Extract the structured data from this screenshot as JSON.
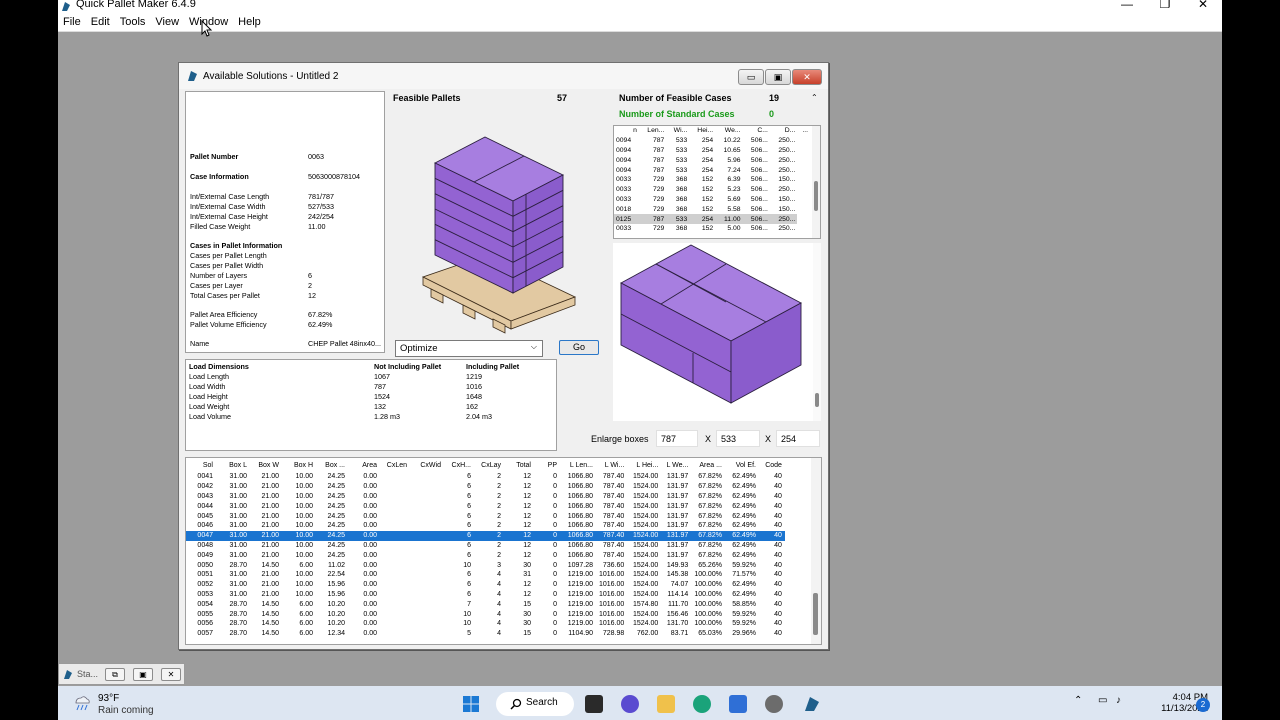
{
  "app": {
    "title": "Quick Pallet Maker 6.4.9",
    "window_buttons": [
      "—",
      "❐",
      "✕"
    ],
    "menu": [
      "File",
      "Edit",
      "Tools",
      "View",
      "Window",
      "Help"
    ]
  },
  "dialog": {
    "title": "Available Solutions - Untitled 2",
    "buttons": [
      "▭",
      "▣",
      "✕"
    ]
  },
  "info": {
    "rows": [
      {
        "label": "Pallet Number",
        "value": "0063",
        "bold": true
      },
      {
        "label": "Case Information",
        "value": "5063000878104",
        "bold": true
      },
      {
        "label": "Int/External Case Length",
        "value": "781/787"
      },
      {
        "label": "Int/External Case Width",
        "value": "527/533"
      },
      {
        "label": "Int/External Case Height",
        "value": "242/254"
      },
      {
        "label": "Filled Case Weight",
        "value": "11.00"
      },
      {
        "label": "Cases in Pallet Information",
        "value": "",
        "bold": true
      },
      {
        "label": "Cases per Pallet Length",
        "value": ""
      },
      {
        "label": "Cases per Pallet Width",
        "value": ""
      },
      {
        "label": "Number of Layers",
        "value": "6"
      },
      {
        "label": "Cases per Layer",
        "value": "2"
      },
      {
        "label": "Total Cases per Pallet",
        "value": "12"
      },
      {
        "label": "Pallet Area Efficiency",
        "value": "67.82%"
      },
      {
        "label": "Pallet Volume Efficiency",
        "value": "62.49%"
      },
      {
        "label": "Name",
        "value": "CHEP Pallet 48inx40..."
      }
    ]
  },
  "load": {
    "headers": [
      "Load Dimensions",
      "Not Including Pallet",
      "Including Pallet"
    ],
    "rows": [
      [
        "Load Length",
        "1067",
        "1219"
      ],
      [
        "Load Width",
        "787",
        "1016"
      ],
      [
        "Load Height",
        "1524",
        "1648"
      ],
      [
        "Load Weight",
        "132",
        "162"
      ],
      [
        "Load Volume",
        "1.28 m3",
        "2.04 m3"
      ]
    ]
  },
  "feasible": {
    "label": "Feasible Pallets",
    "count": "57"
  },
  "cases_summary": {
    "feasible_label": "Number of Feasible Cases",
    "feasible_count": "19",
    "standard_label": "Number of Standard Cases",
    "standard_count": "0"
  },
  "cases_table": {
    "headers": [
      "n",
      "Len...",
      "Wi...",
      "Hei...",
      "We...",
      "C...",
      "D...",
      "..."
    ],
    "rows": [
      [
        "0094",
        "787",
        "533",
        "254",
        "10.22",
        "506...",
        "250..."
      ],
      [
        "0094",
        "787",
        "533",
        "254",
        "10.65",
        "506...",
        "250..."
      ],
      [
        "0094",
        "787",
        "533",
        "254",
        "5.96",
        "506...",
        "250..."
      ],
      [
        "0094",
        "787",
        "533",
        "254",
        "7.24",
        "506...",
        "250..."
      ],
      [
        "0033",
        "729",
        "368",
        "152",
        "6.39",
        "506...",
        "150..."
      ],
      [
        "0033",
        "729",
        "368",
        "152",
        "5.23",
        "506...",
        "250..."
      ],
      [
        "0033",
        "729",
        "368",
        "152",
        "5.69",
        "506...",
        "150..."
      ],
      [
        "0018",
        "729",
        "368",
        "152",
        "5.58",
        "506...",
        "150..."
      ],
      [
        "0125",
        "787",
        "533",
        "254",
        "11.00",
        "506...",
        "250..."
      ],
      [
        "0033",
        "729",
        "368",
        "152",
        "5.00",
        "506...",
        "250..."
      ]
    ],
    "selected_index": 8
  },
  "optimize": {
    "value": "Optimize",
    "go": "Go"
  },
  "enlarge": {
    "label": "Enlarge boxes",
    "x": "787",
    "y": "533",
    "z": "254",
    "sep": "X"
  },
  "solutions": {
    "headers": [
      "Sol",
      "Box L",
      "Box W",
      "Box H",
      "Box ...",
      "Area",
      "CxLen",
      "CxWid",
      "CxH...",
      "CxLay",
      "Total",
      "PP",
      "L Len...",
      "L Wi...",
      "L Hei...",
      "L We...",
      "Area ...",
      "Vol Ef.",
      "Code"
    ],
    "rows": [
      [
        "0041",
        "31.00",
        "21.00",
        "10.00",
        "24.25",
        "0.00",
        "",
        "",
        "6",
        "2",
        "12",
        "0",
        "1066.80",
        "787.40",
        "1524.00",
        "131.97",
        "67.82%",
        "62.49%",
        "40"
      ],
      [
        "0042",
        "31.00",
        "21.00",
        "10.00",
        "24.25",
        "0.00",
        "",
        "",
        "6",
        "2",
        "12",
        "0",
        "1066.80",
        "787.40",
        "1524.00",
        "131.97",
        "67.82%",
        "62.49%",
        "40"
      ],
      [
        "0043",
        "31.00",
        "21.00",
        "10.00",
        "24.25",
        "0.00",
        "",
        "",
        "6",
        "2",
        "12",
        "0",
        "1066.80",
        "787.40",
        "1524.00",
        "131.97",
        "67.82%",
        "62.49%",
        "40"
      ],
      [
        "0044",
        "31.00",
        "21.00",
        "10.00",
        "24.25",
        "0.00",
        "",
        "",
        "6",
        "2",
        "12",
        "0",
        "1066.80",
        "787.40",
        "1524.00",
        "131.97",
        "67.82%",
        "62.49%",
        "40"
      ],
      [
        "0045",
        "31.00",
        "21.00",
        "10.00",
        "24.25",
        "0.00",
        "",
        "",
        "6",
        "2",
        "12",
        "0",
        "1066.80",
        "787.40",
        "1524.00",
        "131.97",
        "67.82%",
        "62.49%",
        "40"
      ],
      [
        "0046",
        "31.00",
        "21.00",
        "10.00",
        "24.25",
        "0.00",
        "",
        "",
        "6",
        "2",
        "12",
        "0",
        "1066.80",
        "787.40",
        "1524.00",
        "131.97",
        "67.82%",
        "62.49%",
        "40"
      ],
      [
        "0047",
        "31.00",
        "21.00",
        "10.00",
        "24.25",
        "0.00",
        "",
        "",
        "6",
        "2",
        "12",
        "0",
        "1066.80",
        "787.40",
        "1524.00",
        "131.97",
        "67.82%",
        "62.49%",
        "40"
      ],
      [
        "0048",
        "31.00",
        "21.00",
        "10.00",
        "24.25",
        "0.00",
        "",
        "",
        "6",
        "2",
        "12",
        "0",
        "1066.80",
        "787.40",
        "1524.00",
        "131.97",
        "67.82%",
        "62.49%",
        "40"
      ],
      [
        "0049",
        "31.00",
        "21.00",
        "10.00",
        "24.25",
        "0.00",
        "",
        "",
        "6",
        "2",
        "12",
        "0",
        "1066.80",
        "787.40",
        "1524.00",
        "131.97",
        "67.82%",
        "62.49%",
        "40"
      ],
      [
        "0050",
        "28.70",
        "14.50",
        "6.00",
        "11.02",
        "0.00",
        "",
        "",
        "10",
        "3",
        "30",
        "0",
        "1097.28",
        "736.60",
        "1524.00",
        "149.93",
        "65.26%",
        "59.92%",
        "40"
      ],
      [
        "0051",
        "31.00",
        "21.00",
        "10.00",
        "22.54",
        "0.00",
        "",
        "",
        "6",
        "4",
        "31",
        "0",
        "1219.00",
        "1016.00",
        "1524.00",
        "145.38",
        "100.00%",
        "71.57%",
        "40"
      ],
      [
        "0052",
        "31.00",
        "21.00",
        "10.00",
        "15.96",
        "0.00",
        "",
        "",
        "6",
        "4",
        "12",
        "0",
        "1219.00",
        "1016.00",
        "1524.00",
        "74.07",
        "100.00%",
        "62.49%",
        "40"
      ],
      [
        "0053",
        "31.00",
        "21.00",
        "10.00",
        "15.96",
        "0.00",
        "",
        "",
        "6",
        "4",
        "12",
        "0",
        "1219.00",
        "1016.00",
        "1524.00",
        "114.14",
        "100.00%",
        "62.49%",
        "40"
      ],
      [
        "0054",
        "28.70",
        "14.50",
        "6.00",
        "10.20",
        "0.00",
        "",
        "",
        "7",
        "4",
        "15",
        "0",
        "1219.00",
        "1016.00",
        "1574.80",
        "111.70",
        "100.00%",
        "58.85%",
        "40"
      ],
      [
        "0055",
        "28.70",
        "14.50",
        "6.00",
        "10.20",
        "0.00",
        "",
        "",
        "10",
        "4",
        "30",
        "0",
        "1219.00",
        "1016.00",
        "1524.00",
        "156.46",
        "100.00%",
        "59.92%",
        "40"
      ],
      [
        "0056",
        "28.70",
        "14.50",
        "6.00",
        "10.20",
        "0.00",
        "",
        "",
        "10",
        "4",
        "30",
        "0",
        "1219.00",
        "1016.00",
        "1524.00",
        "131.70",
        "100.00%",
        "59.92%",
        "40"
      ],
      [
        "0057",
        "28.70",
        "14.50",
        "6.00",
        "12.34",
        "0.00",
        "",
        "",
        "5",
        "4",
        "15",
        "0",
        "1104.90",
        "728.98",
        "762.00",
        "83.71",
        "65.03%",
        "29.96%",
        "40"
      ]
    ],
    "selected_index": 6
  },
  "minimized": {
    "label": "Sta...",
    "buttons": [
      "⧉",
      "▣",
      "✕"
    ]
  },
  "taskbar": {
    "temp": "93°F",
    "weather": "Rain coming",
    "search": "Search",
    "time": "4:04 PM",
    "date": "11/13/2022",
    "badge": "2"
  },
  "colors": {
    "box": "#9a6ad6",
    "box_line": "#2b1f3f",
    "pallet": "#e2c9a2",
    "selection": "#1a74d0"
  }
}
